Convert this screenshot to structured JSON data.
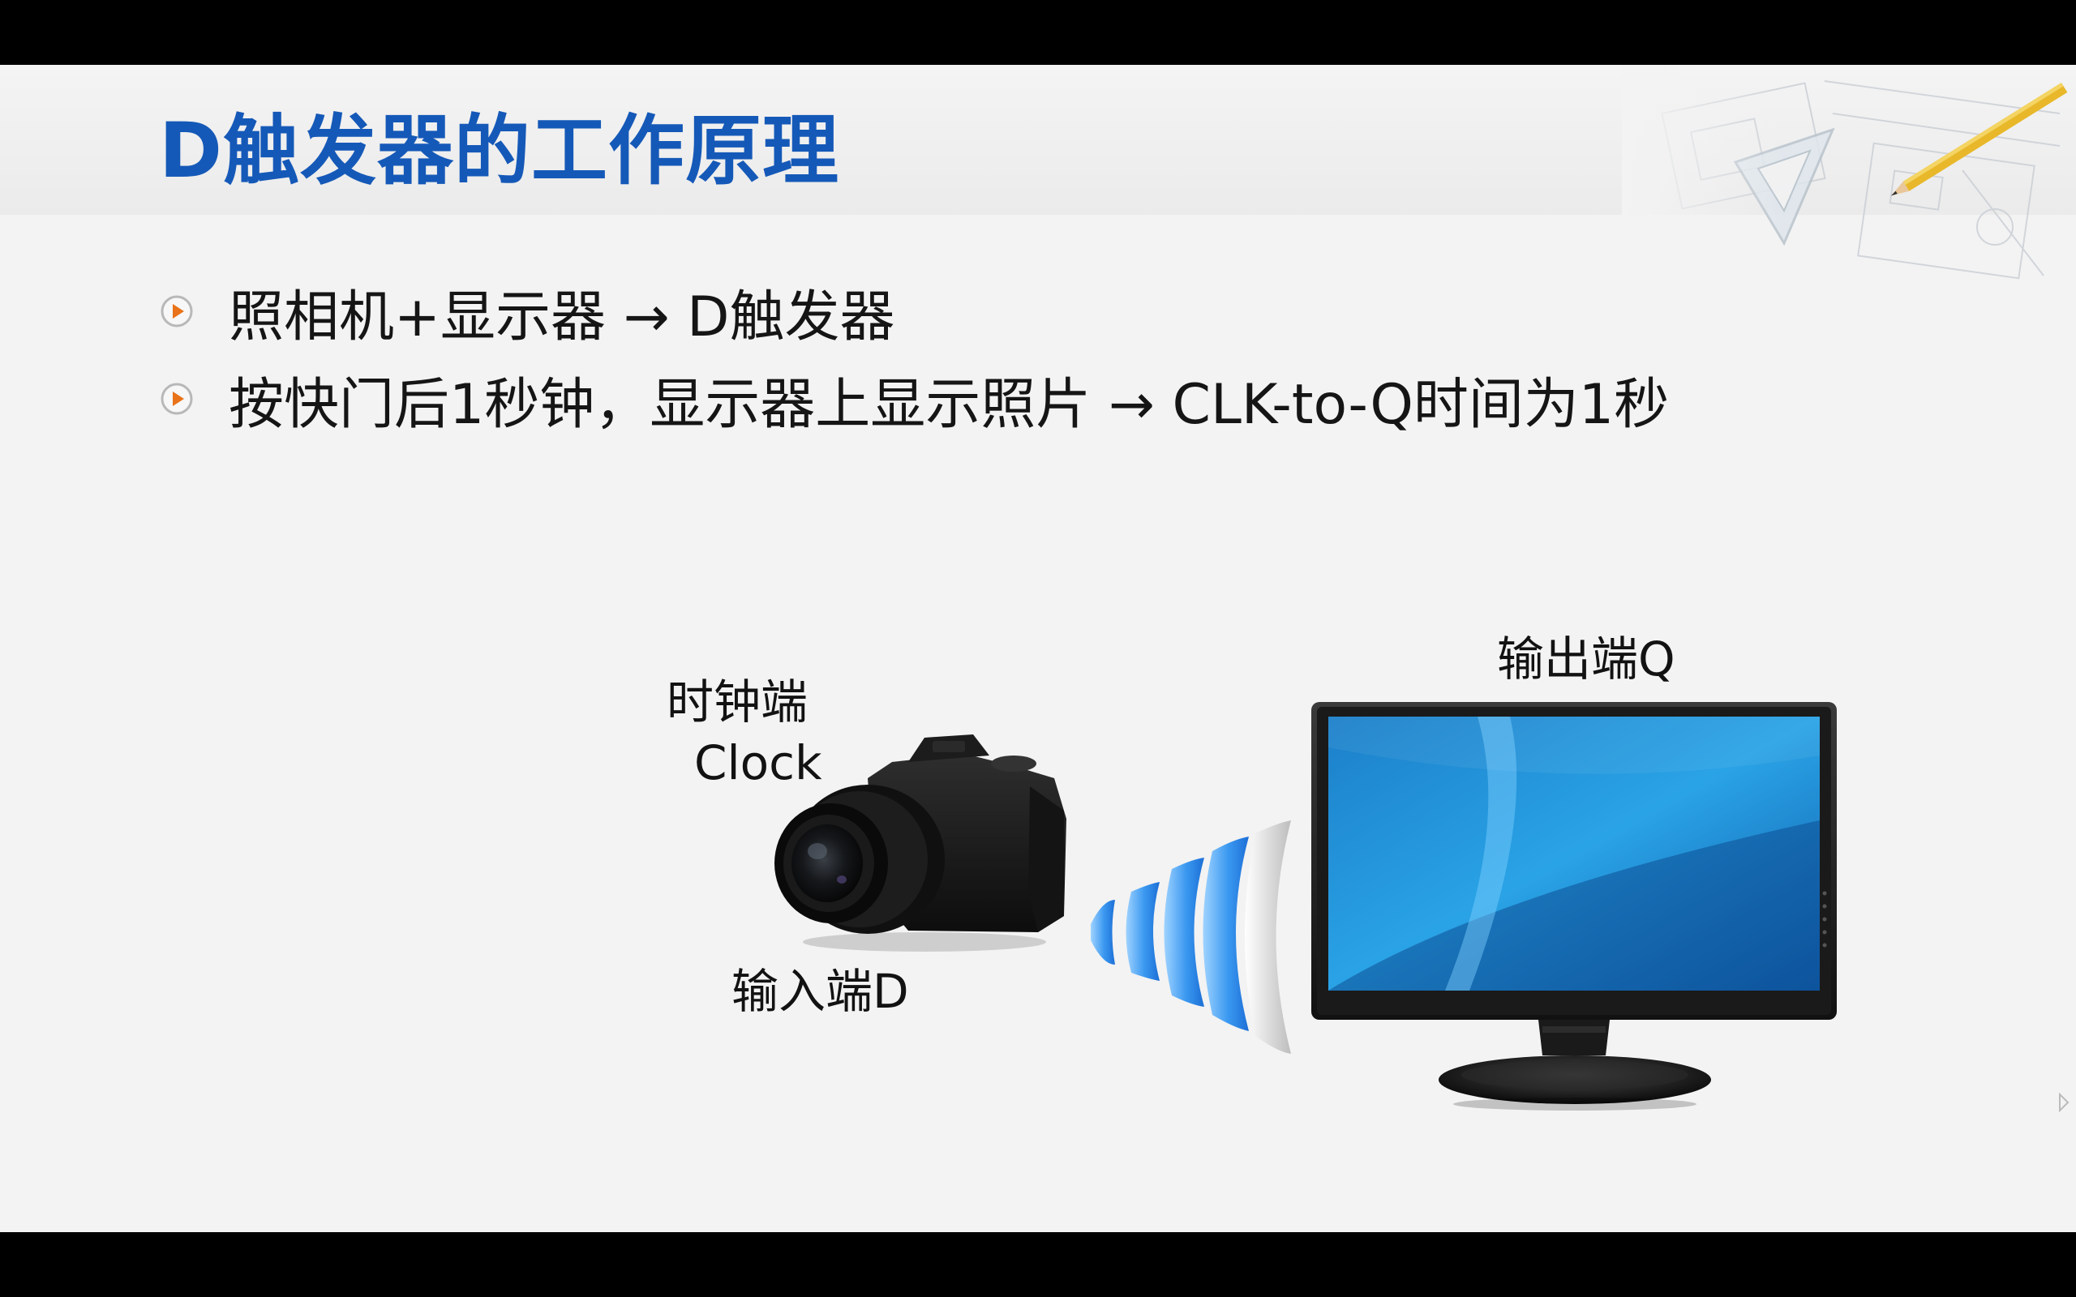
{
  "slide": {
    "title": "D触发器的工作原理",
    "bullets": [
      {
        "text": "照相机+显示器 → D触发器",
        "icon": "play-bullet-icon"
      },
      {
        "text": "按快门后1秒钟，显示器上显示照片 → CLK-to-Q时间为1秒",
        "icon": "play-bullet-icon"
      }
    ],
    "diagram": {
      "clock_label_cn": "时钟端",
      "clock_label_en": "Clock",
      "input_label": "输入端D",
      "output_label": "输出端Q",
      "camera_icon": "camera-icon",
      "signal_icon": "wireless-signal-icon",
      "monitor_icon": "monitor-icon"
    }
  },
  "colors": {
    "title": "#1559b8",
    "bullet_accent": "#e8731a",
    "screen_blue": "#1a8fd8",
    "letterbox": "#000000"
  }
}
